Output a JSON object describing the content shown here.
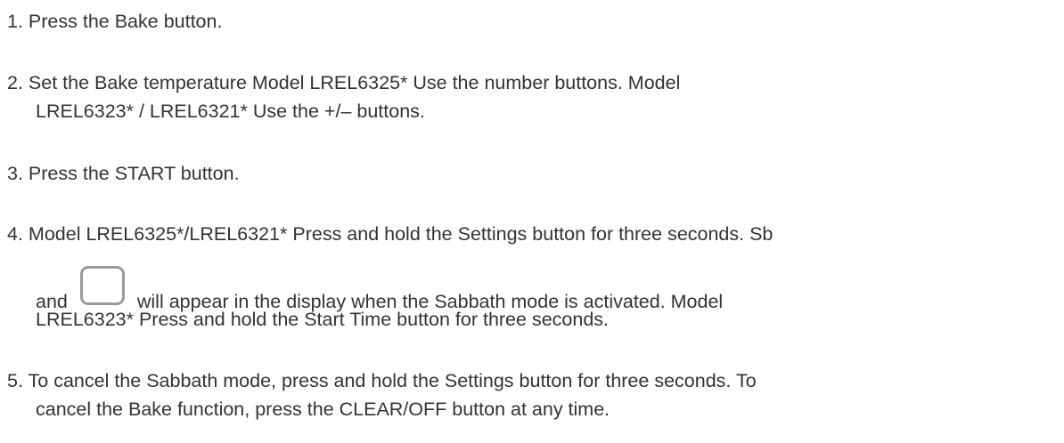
{
  "steps": [
    {
      "number": "1.",
      "text": "Press the Bake button."
    },
    {
      "number": "2.",
      "line1": "Set the Bake temperature Model LREL6325* Use the number buttons. Model",
      "line2": "LREL6323* / LREL6321* Use the +/– buttons."
    },
    {
      "number": "3.",
      "text": "Press the START button."
    },
    {
      "number": "4.",
      "line1": "Model LREL6325*/LREL6321* Press and hold the Settings button for three seconds. Sb",
      "line2_before_icon": "and",
      "icon": "sabbath-mode-icon",
      "line2_after_icon": "will appear in the display when the Sabbath mode is activated. Model",
      "line3": "LREL6323* Press and hold the Start Time button for three seconds."
    },
    {
      "number": "5.",
      "line1": "To cancel the Sabbath mode, press and hold the Settings button for three seconds. To",
      "line2": "cancel the Bake function, press the CLEAR/OFF button at any time."
    }
  ],
  "colors": {
    "text": "#333333",
    "icon_border": "#9a9a9a",
    "background": "#ffffff"
  }
}
